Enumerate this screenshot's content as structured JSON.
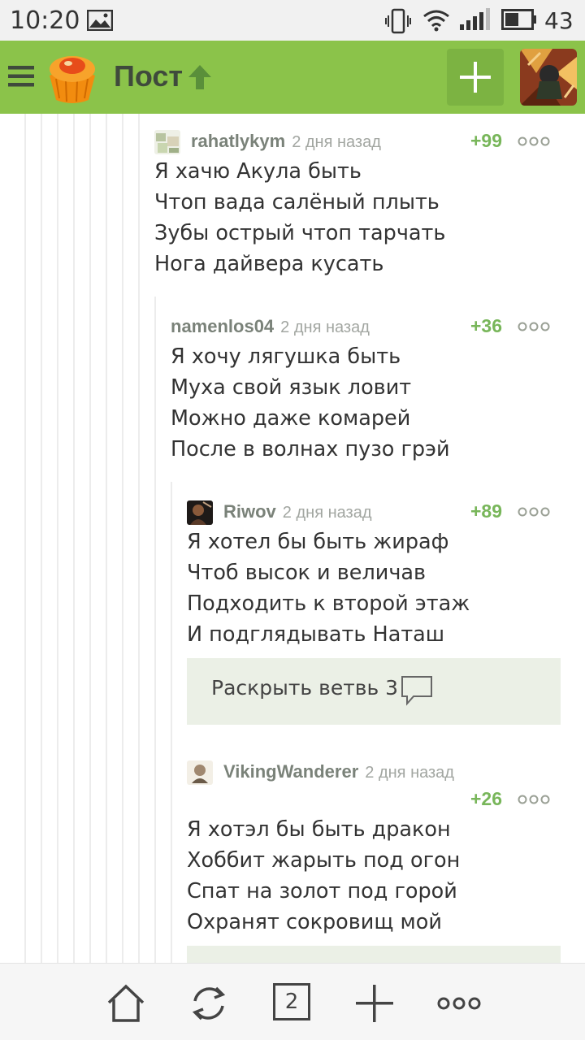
{
  "status_bar": {
    "time": "10:20",
    "battery": "43",
    "icons": [
      "image-icon",
      "vibrate-icon",
      "wifi-icon",
      "signal-icon",
      "battery-icon"
    ]
  },
  "header": {
    "title": "Пост",
    "icons": [
      "menu-icon",
      "app-logo",
      "arrow-up-icon",
      "plus-icon",
      "profile-avatar"
    ],
    "accent_color": "#8bc34a"
  },
  "comments": [
    {
      "user": "rahatlykym",
      "time": "2 дня назад",
      "score": "+99",
      "lines": [
        "Я хачю Акула быть",
        "Чтоп вада салёный плыть",
        "Зубы острый чтоп тарчать",
        "Нога дайвера кусать"
      ]
    },
    {
      "user": "namenlos04",
      "time": "2 дня назад",
      "score": "+36",
      "lines": [
        "Я хочу лягушка быть",
        "Муха свой язык ловит",
        "Можно даже комарей",
        "После в волнах пузо грэй"
      ]
    },
    {
      "user": "Riwov",
      "time": "2 дня назад",
      "score": "+89",
      "lines": [
        "Я хотел бы быть жираф",
        "Чтоб высок и величав",
        "Подходить к второй этаж",
        "И подглядывать Наташ"
      ]
    },
    {
      "user": "VikingWanderer",
      "time": "2 дня назад",
      "score": "+26",
      "lines": [
        "Я хотэл бы быть дракон",
        "Хоббит жарыть под огон",
        "Спат на золот под горой",
        "Охранят сокровищ мой"
      ]
    }
  ],
  "expand_branch": {
    "label": "Раскрыть ветвь 3",
    "icon": "comment-bubble-icon"
  },
  "bottom_nav": {
    "items": [
      "home-icon",
      "refresh-icon",
      "tabs-count",
      "plus-icon",
      "more-icon"
    ],
    "tabs_count": "2"
  }
}
